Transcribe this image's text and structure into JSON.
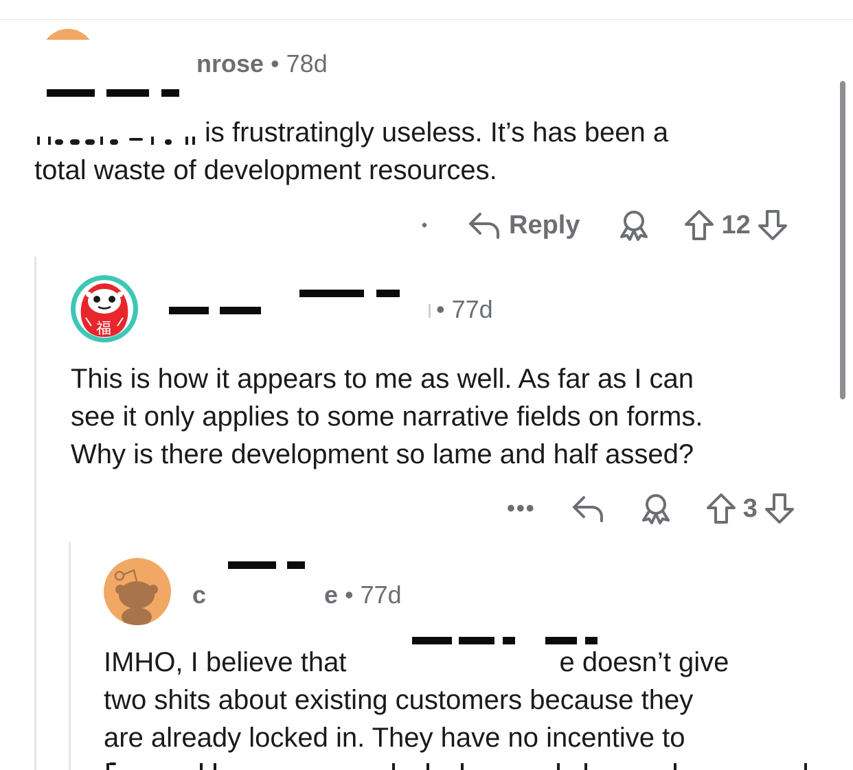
{
  "comment1": {
    "username": "nrose",
    "age": "78d",
    "lines": [
      "is frustratingly useless. It’s has been a",
      "total waste of development resources."
    ],
    "reply_label": "Reply",
    "votes": "12",
    "icons": {
      "reply": "reply-arrow-icon",
      "award": "award-icon",
      "upvote": "upvote-arrow-icon",
      "downvote": "downvote-arrow-icon"
    }
  },
  "comment2": {
    "age": "77d",
    "lines": [
      "This is how it appears to me as well.  As far as I can",
      "see it only applies to some narrative fields on forms.",
      "Why is there development so lame and half assed?"
    ],
    "more_label": "•••",
    "votes": "3",
    "avatar": {
      "name": "daruma-avatar",
      "glyph": "福",
      "ring_color": "#3ec6b6",
      "fill_color": "#e8262b"
    }
  },
  "comment3": {
    "username_start": "c",
    "username_end": "e",
    "age": "77d",
    "lines": [
      {
        "before": "IMHO, I believe that",
        "after": "e doesn’t give"
      },
      "two shits about existing customers because they",
      "are already locked in. They have no incentive to"
    ],
    "avatar": {
      "name": "snoo-avatar",
      "bg_color": "#f2a865",
      "figure_color": "#a9744a"
    }
  }
}
